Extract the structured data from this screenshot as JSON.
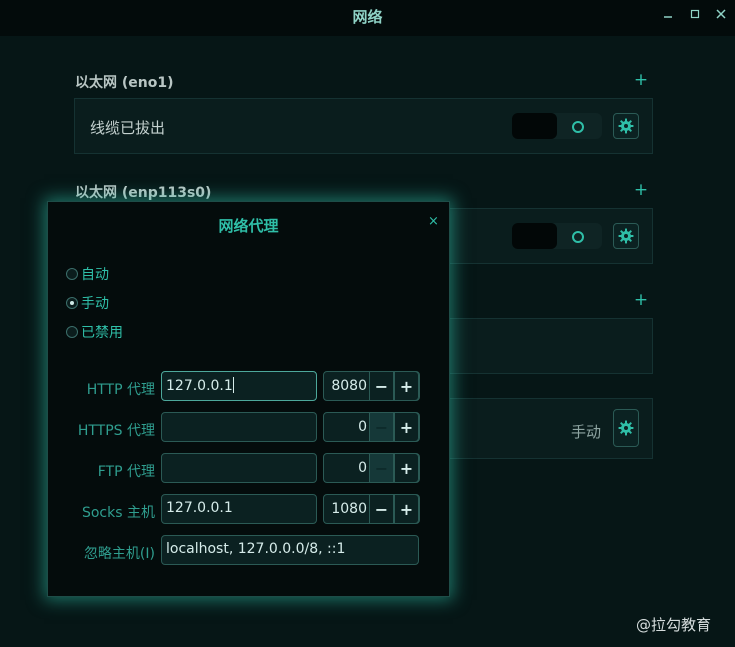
{
  "window": {
    "title": "网络"
  },
  "sections": [
    {
      "title": "以太网 (eno1)",
      "row_label": "线缆已拔出"
    },
    {
      "title": "以太网 (enp113s0)"
    }
  ],
  "proxy_row": {
    "status": "手动"
  },
  "dialog": {
    "title": "网络代理",
    "close": "×",
    "radios": [
      {
        "label": "自动",
        "selected": false
      },
      {
        "label": "手动",
        "selected": true
      },
      {
        "label": "已禁用",
        "selected": false
      }
    ],
    "fields": {
      "http": {
        "label": "HTTP 代理",
        "host": "127.0.0.1",
        "port": "8080"
      },
      "https": {
        "label": "HTTPS 代理",
        "host": "",
        "port": "0"
      },
      "ftp": {
        "label": "FTP 代理",
        "host": "",
        "port": "0"
      },
      "socks": {
        "label": "Socks 主机",
        "host": "127.0.0.1",
        "port": "1080"
      },
      "ignore": {
        "label": "忽略主机(I)",
        "value": "localhost, 127.0.0.0/8, ::1"
      }
    },
    "spin": {
      "minus": "−",
      "plus": "+"
    }
  },
  "watermark": "@拉勾教育",
  "icons": {
    "add": "+",
    "settings": "gear-icon"
  },
  "colors": {
    "accent": "#2fbfa8",
    "background": "#061616",
    "panel": "#0a1d1d"
  }
}
